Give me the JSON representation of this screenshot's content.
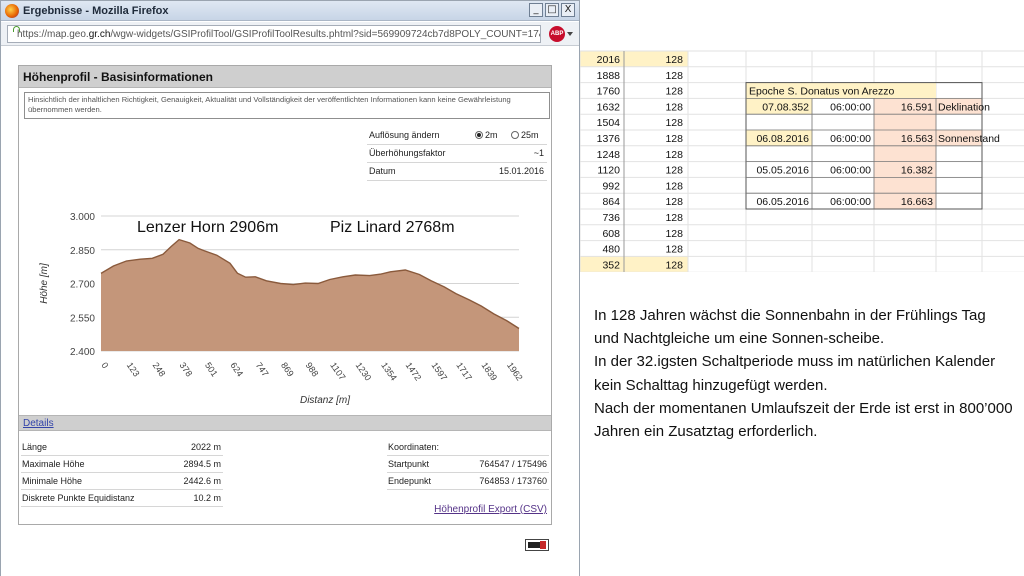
{
  "browser": {
    "title": "Ergebnisse - Mozilla Firefox",
    "url_prefix": "https://map.geo.",
    "url_domain": "gr.ch",
    "url_rest": "/wgw-widgets/GSIProfilTool/GSIProfilToolResults.phtml?sid=569909724cb7d8POLY_COUNT=17&coords=76454",
    "adblock_label": "ABP",
    "window_buttons": [
      "_",
      "□",
      "X"
    ]
  },
  "panel": {
    "title": "Höhenprofil - Basisinformationen",
    "disclaimer": "Hinsichtlich der inhaltlichen Richtigkeit, Genauigkeit, Aktualität und Vollständigkeit der veröffentlichten Informationen kann keine Gewährleistung übernommen werden.",
    "resolution_label": "Auflösung ändern",
    "resolution_options": [
      "2m",
      "25m"
    ],
    "resolution_selected": "2m",
    "exaggeration_label": "Überhöhungsfaktor",
    "exaggeration_value": "~1",
    "date_label": "Datum",
    "date_value": "15.01.2016",
    "details_label": "Details",
    "export_label": "Höhenprofil Export (CSV)"
  },
  "stats": {
    "left": [
      {
        "label": "Länge",
        "value": "2022 m"
      },
      {
        "label": "Maximale Höhe",
        "value": "2894.5 m"
      },
      {
        "label": "Minimale Höhe",
        "value": "2442.6 m"
      },
      {
        "label": "Diskrete Punkte Equidistanz",
        "value": "10.2 m"
      }
    ],
    "coords_label": "Koordinaten:",
    "right": [
      {
        "label": "Startpunkt",
        "value": "764547 / 175496"
      },
      {
        "label": "Endepunkt",
        "value": "764853 / 173760"
      }
    ]
  },
  "chart_data": {
    "type": "area",
    "xlabel": "Distanz [m]",
    "ylabel": "Höhe [m]",
    "ylim": [
      2400,
      3000
    ],
    "xlim": [
      0,
      2022
    ],
    "y_ticks": [
      "3.000",
      "2.850",
      "2.700",
      "2.550",
      "2.400"
    ],
    "x_ticks": [
      0,
      123,
      248,
      378,
      501,
      624,
      747,
      869,
      988,
      1107,
      1230,
      1354,
      1472,
      1597,
      1717,
      1839,
      1962
    ],
    "annotations": [
      "Lenzer Horn 2906m",
      "Piz Linard 2768m"
    ],
    "fill_color": "#c4967a",
    "line_color": "#8a5a3c",
    "x": [
      0,
      60,
      123,
      190,
      248,
      300,
      340,
      378,
      430,
      470,
      501,
      560,
      624,
      660,
      700,
      747,
      800,
      869,
      930,
      988,
      1050,
      1107,
      1170,
      1230,
      1300,
      1354,
      1400,
      1472,
      1540,
      1597,
      1660,
      1717,
      1780,
      1839,
      1900,
      1962,
      2022
    ],
    "y": [
      2745,
      2778,
      2800,
      2808,
      2812,
      2830,
      2865,
      2895,
      2880,
      2856,
      2845,
      2826,
      2790,
      2746,
      2728,
      2730,
      2712,
      2700,
      2695,
      2702,
      2700,
      2718,
      2730,
      2738,
      2735,
      2742,
      2752,
      2760,
      2740,
      2712,
      2685,
      2655,
      2628,
      2600,
      2565,
      2535,
      2500
    ]
  },
  "sheet": {
    "col_a": [
      "2016",
      "1888",
      "1760",
      "1632",
      "1504",
      "1376",
      "1248",
      "1120",
      "992",
      "864",
      "736",
      "608",
      "480",
      "352"
    ],
    "col_b": [
      "128",
      "128",
      "128",
      "128",
      "128",
      "128",
      "128",
      "128",
      "128",
      "128",
      "128",
      "128",
      "128",
      "128"
    ],
    "epoch_title": "Epoche  S. Donatus von Arezzo",
    "epoch_rows": [
      {
        "date": "07.08.352",
        "time": "06:00:00",
        "value": "16.591",
        "note": "Deklination"
      },
      {
        "date": "",
        "time": "",
        "value": "",
        "note": ""
      },
      {
        "date": "06.08.2016",
        "time": "06:00:00",
        "value": "16.563",
        "note": "Sonnenstand"
      },
      {
        "date": "",
        "time": "",
        "value": "",
        "note": ""
      },
      {
        "date": "05.05.2016",
        "time": "06:00:00",
        "value": "16.382",
        "note": ""
      },
      {
        "date": "",
        "time": "",
        "value": "",
        "note": ""
      },
      {
        "date": "06.05.2016",
        "time": "06:00:00",
        "value": "16.663",
        "note": ""
      }
    ]
  },
  "notes": [
    "In 128 Jahren wächst die Sonnenbahn in der Frühlings Tag und Nachtgleiche um eine Sonnen-scheibe.",
    "In der 32.igsten Schaltperiode muss im natürlichen Kalender kein Schalttag  hinzugefügt werden.",
    "Nach der momentanen Umlaufszeit der Erde ist erst in 800’000 Jahren ein Zusatztag erforderlich."
  ]
}
